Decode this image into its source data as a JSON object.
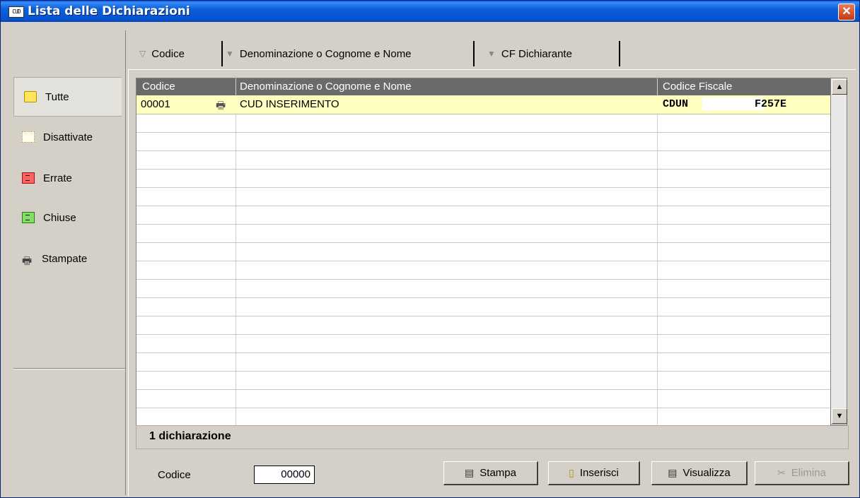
{
  "window": {
    "title": "Lista delle Dichiarazioni",
    "app_icon_text": "CUD"
  },
  "sidebar": {
    "items": [
      {
        "label": "Tutte",
        "icon": "yellow-folder-icon",
        "selected": true
      },
      {
        "label": "Disattivate",
        "icon": "blank-document-icon"
      },
      {
        "label": "Errate",
        "icon": "red-document-icon"
      },
      {
        "label": "Chiuse",
        "icon": "green-document-icon"
      },
      {
        "label": "Stampate",
        "icon": "printer-icon"
      }
    ]
  },
  "tabs": [
    {
      "label": "Codice",
      "active": true
    },
    {
      "label": "Denominazione o Cognome e Nome"
    },
    {
      "label": "CF Dichiarante"
    }
  ],
  "table": {
    "columns": [
      "Codice",
      "Denominazione o Cognome e Nome",
      "Codice Fiscale"
    ],
    "rows": [
      {
        "codice": "00001",
        "denominazione": "CUD INSERIMENTO",
        "cf_start": "CDUN",
        "cf_end": "F257E",
        "printed": true
      }
    ]
  },
  "status": {
    "count_text": "1 dichiarazione"
  },
  "bottom": {
    "codice_label": "Codice",
    "codice_value": "00000",
    "buttons": {
      "stampa": "Stampa",
      "inserisci": "Inserisci",
      "visualizza": "Visualizza",
      "elimina": "Elimina"
    }
  }
}
